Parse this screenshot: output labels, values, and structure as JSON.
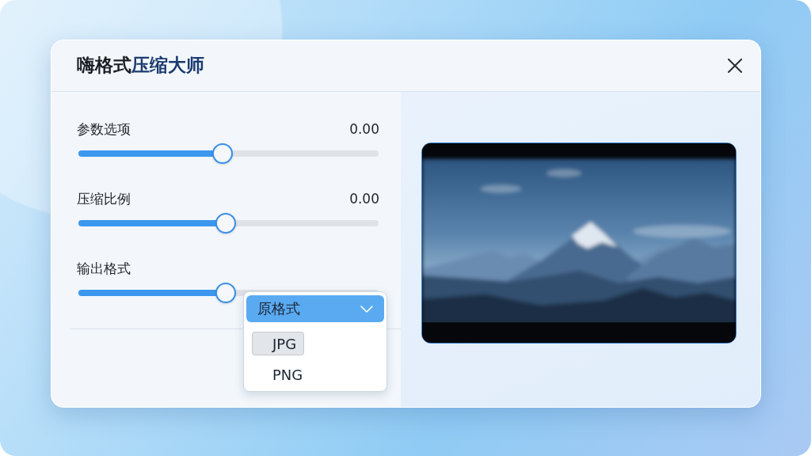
{
  "window": {
    "title": {
      "lead": "嗨格式",
      "accent": "压缩大师"
    }
  },
  "settings": [
    {
      "label": "参数选项",
      "value": "0.00",
      "level": 0.48
    },
    {
      "label": "压缩比例",
      "value": "0.00",
      "level": 0.49
    },
    {
      "label": "输出格式",
      "level": 0.49
    }
  ],
  "format_dropdown": {
    "value": "原格式",
    "open": true,
    "options": [
      {
        "label": "JPG",
        "highlighted": true
      },
      {
        "label": "PNG",
        "highlighted": false
      }
    ]
  }
}
